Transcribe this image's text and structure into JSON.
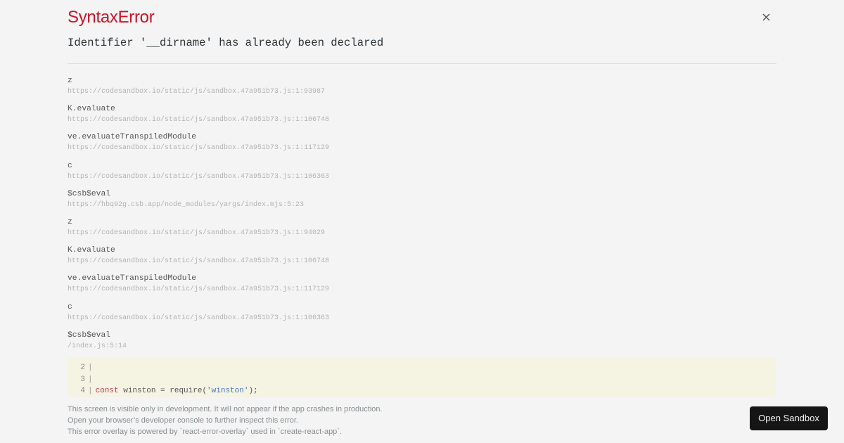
{
  "error": {
    "title": "SyntaxError",
    "message": "Identifier '__dirname' has already been declared"
  },
  "close_icon": "close-icon",
  "stack_frames": [
    {
      "function": "z",
      "location": "https://codesandbox.io/static/js/sandbox.47a951b73.js:1:93987"
    },
    {
      "function": "K.evaluate",
      "location": "https://codesandbox.io/static/js/sandbox.47a951b73.js:1:106748"
    },
    {
      "function": "ve.evaluateTranspiledModule",
      "location": "https://codesandbox.io/static/js/sandbox.47a951b73.js:1:117129"
    },
    {
      "function": "c",
      "location": "https://codesandbox.io/static/js/sandbox.47a951b73.js:1:106363"
    },
    {
      "function": "$csb$eval",
      "location": "https://hbq92g.csb.app/node_modules/yargs/index.mjs:5:23"
    },
    {
      "function": "z",
      "location": "https://codesandbox.io/static/js/sandbox.47a951b73.js:1:94029"
    },
    {
      "function": "K.evaluate",
      "location": "https://codesandbox.io/static/js/sandbox.47a951b73.js:1:106748"
    },
    {
      "function": "ve.evaluateTranspiledModule",
      "location": "https://codesandbox.io/static/js/sandbox.47a951b73.js:1:117129"
    },
    {
      "function": "c",
      "location": "https://codesandbox.io/static/js/sandbox.47a951b73.js:1:106363"
    },
    {
      "function": "$csb$eval",
      "location": "/index.js:5:14"
    }
  ],
  "code_snippet": {
    "lines": [
      {
        "number": "2",
        "keyword": "",
        "pre": "",
        "string": "",
        "post": ""
      },
      {
        "number": "3",
        "keyword": "",
        "pre": "",
        "string": "",
        "post": ""
      },
      {
        "number": "4",
        "keyword": "const",
        "pre": " winston = require(",
        "string": "'winston'",
        "post": ");"
      }
    ]
  },
  "footer": {
    "line1": "This screen is visible only in development. It will not appear if the app crashes in production.",
    "line2": "Open your browser’s developer console to further inspect this error.",
    "line3": "This error overlay is powered by `react-error-overlay` used in `create-react-app`."
  },
  "open_sandbox_label": "Open Sandbox",
  "colors": {
    "error_title": "#ce1126",
    "background": "#f4f4f4",
    "code_background": "#f5f3e2",
    "keyword": "#c23b4f",
    "string": "#3f74c6",
    "button_background": "#151515"
  }
}
